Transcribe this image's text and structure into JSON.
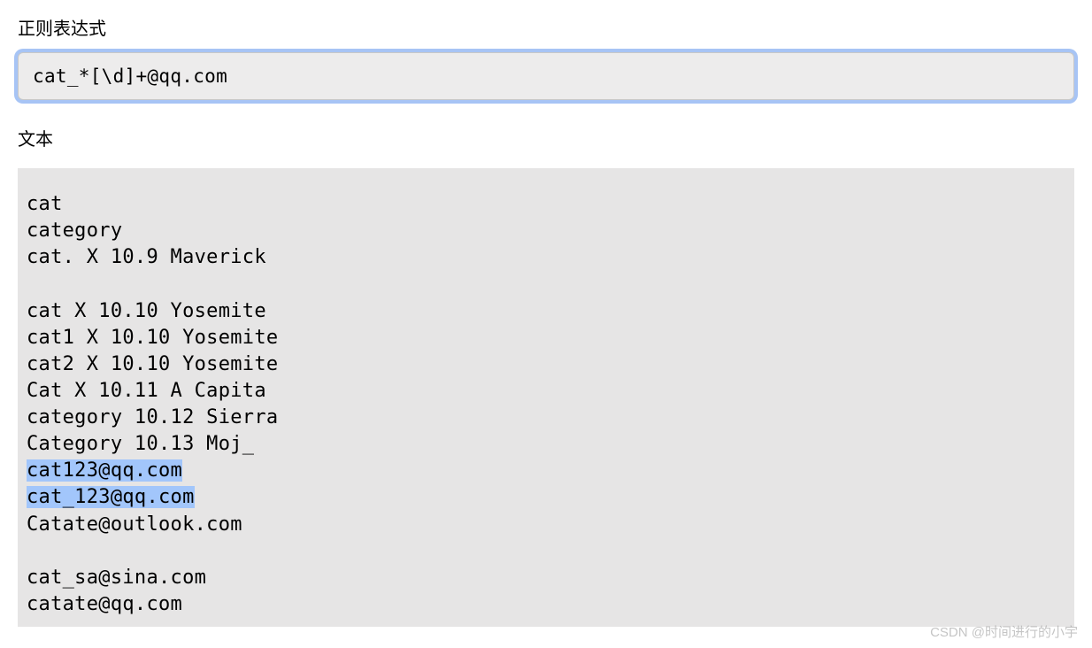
{
  "labels": {
    "regex": "正则表达式",
    "text": "文本"
  },
  "regex_input": {
    "value": "cat_*[\\d]+@qq.com"
  },
  "text_content": {
    "lines": [
      {
        "text": "cat",
        "highlighted": false
      },
      {
        "text": "category",
        "highlighted": false
      },
      {
        "text": "cat. X 10.9 Maverick",
        "highlighted": false
      },
      {
        "text": "",
        "highlighted": false
      },
      {
        "text": "cat X 10.10 Yosemite",
        "highlighted": false
      },
      {
        "text": "cat1 X 10.10 Yosemite",
        "highlighted": false
      },
      {
        "text": "cat2 X 10.10 Yosemite",
        "highlighted": false
      },
      {
        "text": "Cat X 10.11 A Capita",
        "highlighted": false
      },
      {
        "text": "category 10.12 Sierra",
        "highlighted": false
      },
      {
        "text": "Category 10.13 Moj_",
        "highlighted": false
      },
      {
        "text": "cat123@qq.com",
        "highlighted": true
      },
      {
        "text": "cat_123@qq.com",
        "highlighted": true
      },
      {
        "text": "Catate@outlook.com",
        "highlighted": false
      },
      {
        "text": "",
        "highlighted": false
      },
      {
        "text": "cat_sa@sina.com",
        "highlighted": false
      },
      {
        "text": "catate@qq.com",
        "highlighted": false
      }
    ]
  },
  "watermark": "CSDN @时间进行的小宇"
}
